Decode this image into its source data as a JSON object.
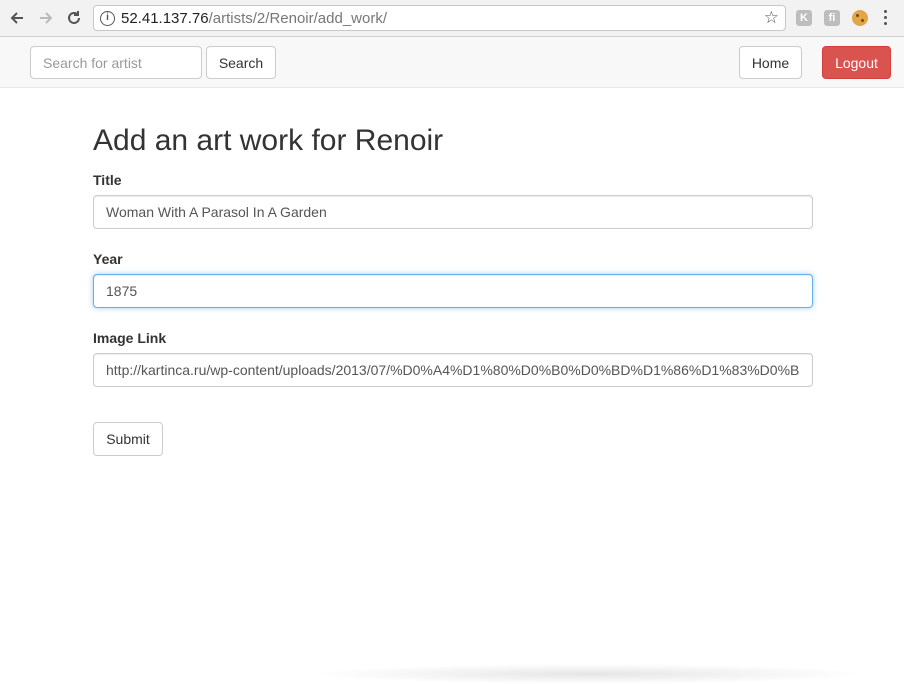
{
  "browser": {
    "url_host": "52.41.137.76",
    "url_path": "/artists/2/Renoir/add_work/",
    "extensions": [
      "K",
      "fi"
    ]
  },
  "navbar": {
    "search_placeholder": "Search for artist",
    "search_label": "Search",
    "home_label": "Home",
    "logout_label": "Logout",
    "logout_color": "#d9534f"
  },
  "form": {
    "heading": "Add an art work for Renoir",
    "title_label": "Title",
    "title_value": "Woman With A Parasol In A Garden",
    "year_label": "Year",
    "year_value": "1875",
    "image_label": "Image Link",
    "image_value": "http://kartinca.ru/wp-content/uploads/2013/07/%D0%A4%D1%80%D0%B0%D0%BD%D1%86%D1%83%D0%B",
    "submit_label": "Submit"
  }
}
